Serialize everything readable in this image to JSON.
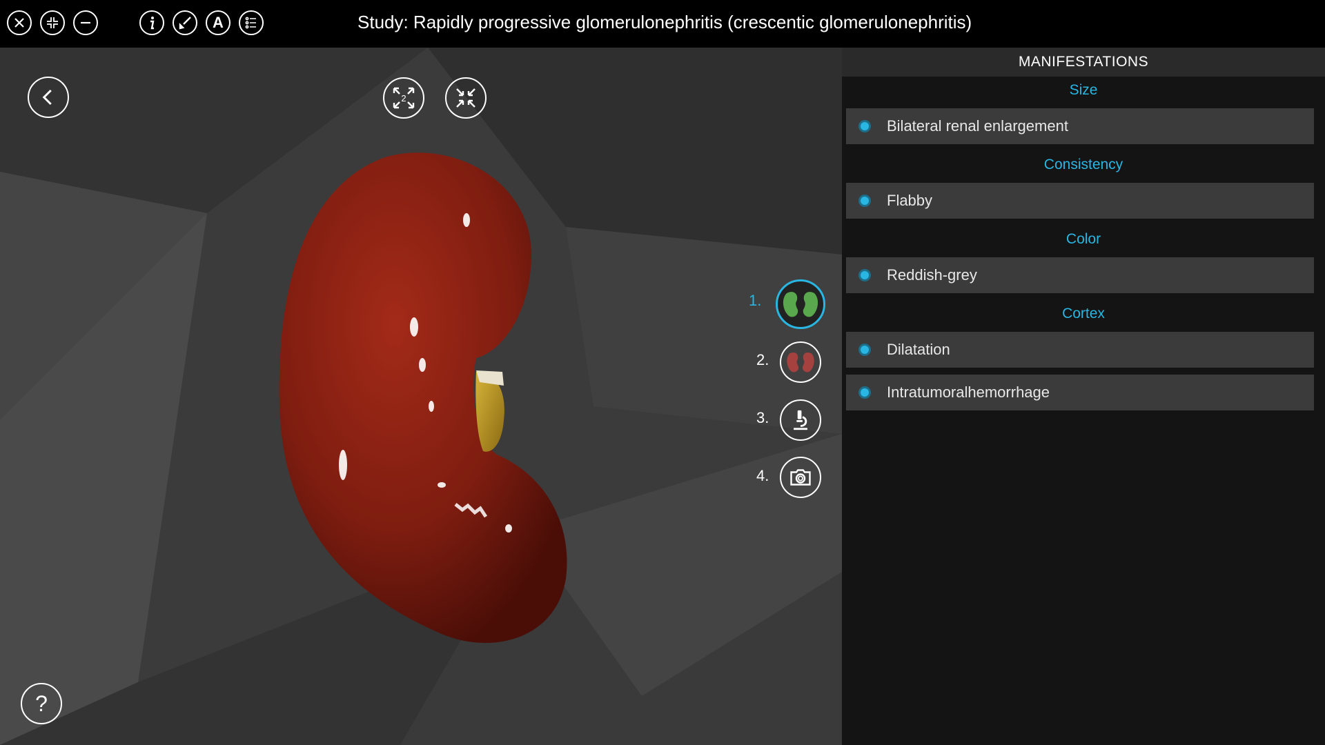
{
  "window": {
    "title": "Study: Rapidly progressive glomerulonephritis (crescentic glomerulonephritis)"
  },
  "toolbar": {
    "icons": [
      "close-icon",
      "shrink-icon",
      "minimize-icon",
      "info-icon",
      "brush-icon",
      "annotation-icon",
      "list-icon"
    ],
    "annotation_letter": "A"
  },
  "viewport": {
    "expand_badge": "2",
    "steps": [
      {
        "label": "1.",
        "icon": "kidney-green-icon",
        "active": true
      },
      {
        "label": "2.",
        "icon": "kidney-red-icon",
        "active": false
      },
      {
        "label": "3.",
        "icon": "microscope-icon",
        "active": false
      },
      {
        "label": "4.",
        "icon": "camera-icon",
        "active": false
      }
    ]
  },
  "panel": {
    "header": "MANIFESTATIONS",
    "sections": [
      {
        "title": "Size",
        "items": [
          "Bilateral renal enlargement"
        ]
      },
      {
        "title": "Consistency",
        "items": [
          "Flabby"
        ]
      },
      {
        "title": "Color",
        "items": [
          "Reddish-grey"
        ]
      },
      {
        "title": "Cortex",
        "items": [
          "Dilatation",
          "Intratumoralhemorrhage"
        ]
      }
    ]
  },
  "colors": {
    "accent": "#29b6e3",
    "kidney": "#8a1f12",
    "panel_bg": "#141414",
    "item_bg": "#3b3b3b"
  }
}
